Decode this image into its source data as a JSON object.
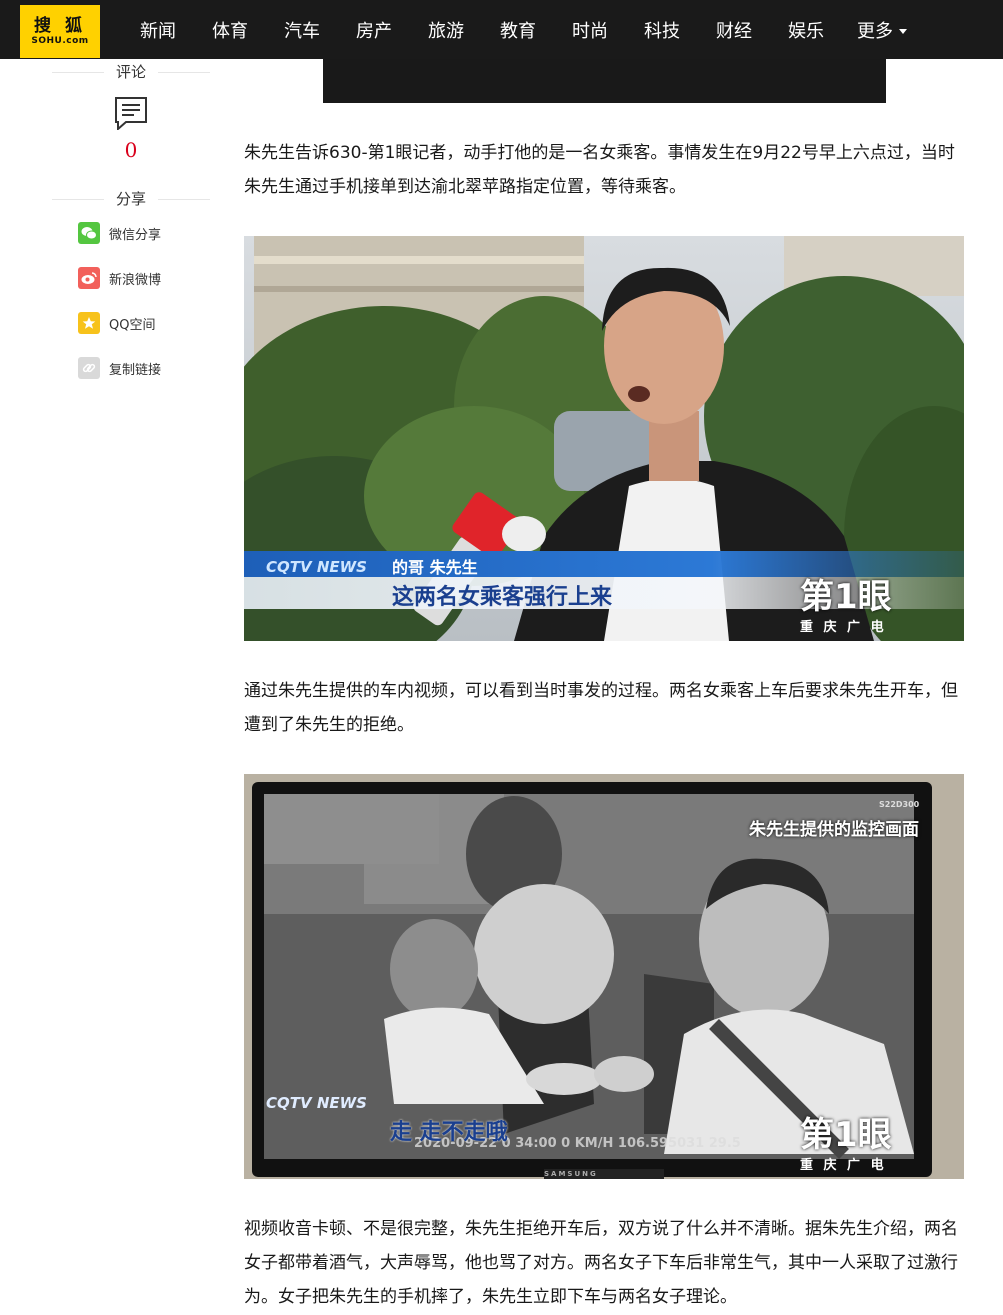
{
  "brand": {
    "logo_cn": "搜 狐",
    "logo_en": "SOHU.com"
  },
  "nav": {
    "items": [
      "新闻",
      "体育",
      "汽车",
      "房产",
      "旅游",
      "教育",
      "时尚",
      "科技",
      "财经",
      "娱乐"
    ],
    "more_label": "更多"
  },
  "sidebar": {
    "comment_label": "评论",
    "comment_count": "0",
    "share_label": "分享",
    "share_items": [
      {
        "label": "微信分享",
        "icon": "wechat-icon",
        "color": "#54c640"
      },
      {
        "label": "新浪微博",
        "icon": "weibo-icon",
        "color": "#f2605b"
      },
      {
        "label": "QQ空间",
        "icon": "qzone-icon",
        "color": "#f7c21b"
      },
      {
        "label": "复制链接",
        "icon": "link-icon",
        "color": "#d9d9d9"
      }
    ]
  },
  "article": {
    "para1": "朱先生告诉630-第1眼记者，动手打他的是一名女乘客。事情发生在9月22号早上六点过，当时朱先生通过手机接单到达渝北翠苹路指定位置，等待乘客。",
    "para2": "通过朱先生提供的车内视频，可以看到当时事发的过程。两名女乘客上车后要求朱先生开车，但遭到了朱先生的拒绝。",
    "para3": "视频收音卡顿、不是很完整，朱先生拒绝开车后，双方说了什么并不清晰。据朱先生介绍，两名女子都带着酒气，大声辱骂，他也骂了对方。两名女子下车后非常生气，其中一人采取了过激行为。女子把朱先生的手机摔了，朱先生立即下车与两名女子理论。"
  },
  "image1": {
    "speaker_tag": "的哥 朱先生",
    "subtitle": "这两名女乘客强行上来",
    "channel": "CQTV NEWS",
    "station_logo": "第1眼",
    "station_sub": "重 庆 广 电"
  },
  "image2": {
    "overlay_title": "朱先生提供的监控画面",
    "subtitle": "走 走不走哦",
    "channel": "CQTV NEWS",
    "station_logo": "第1眼",
    "station_sub": "重 庆 广 电",
    "dashcam_text": "2020-09-22  0   34:00      0  KM/H   106.595031  29.5",
    "monitor_brand": "SAMSUNG",
    "device_tag": "S22D300"
  }
}
